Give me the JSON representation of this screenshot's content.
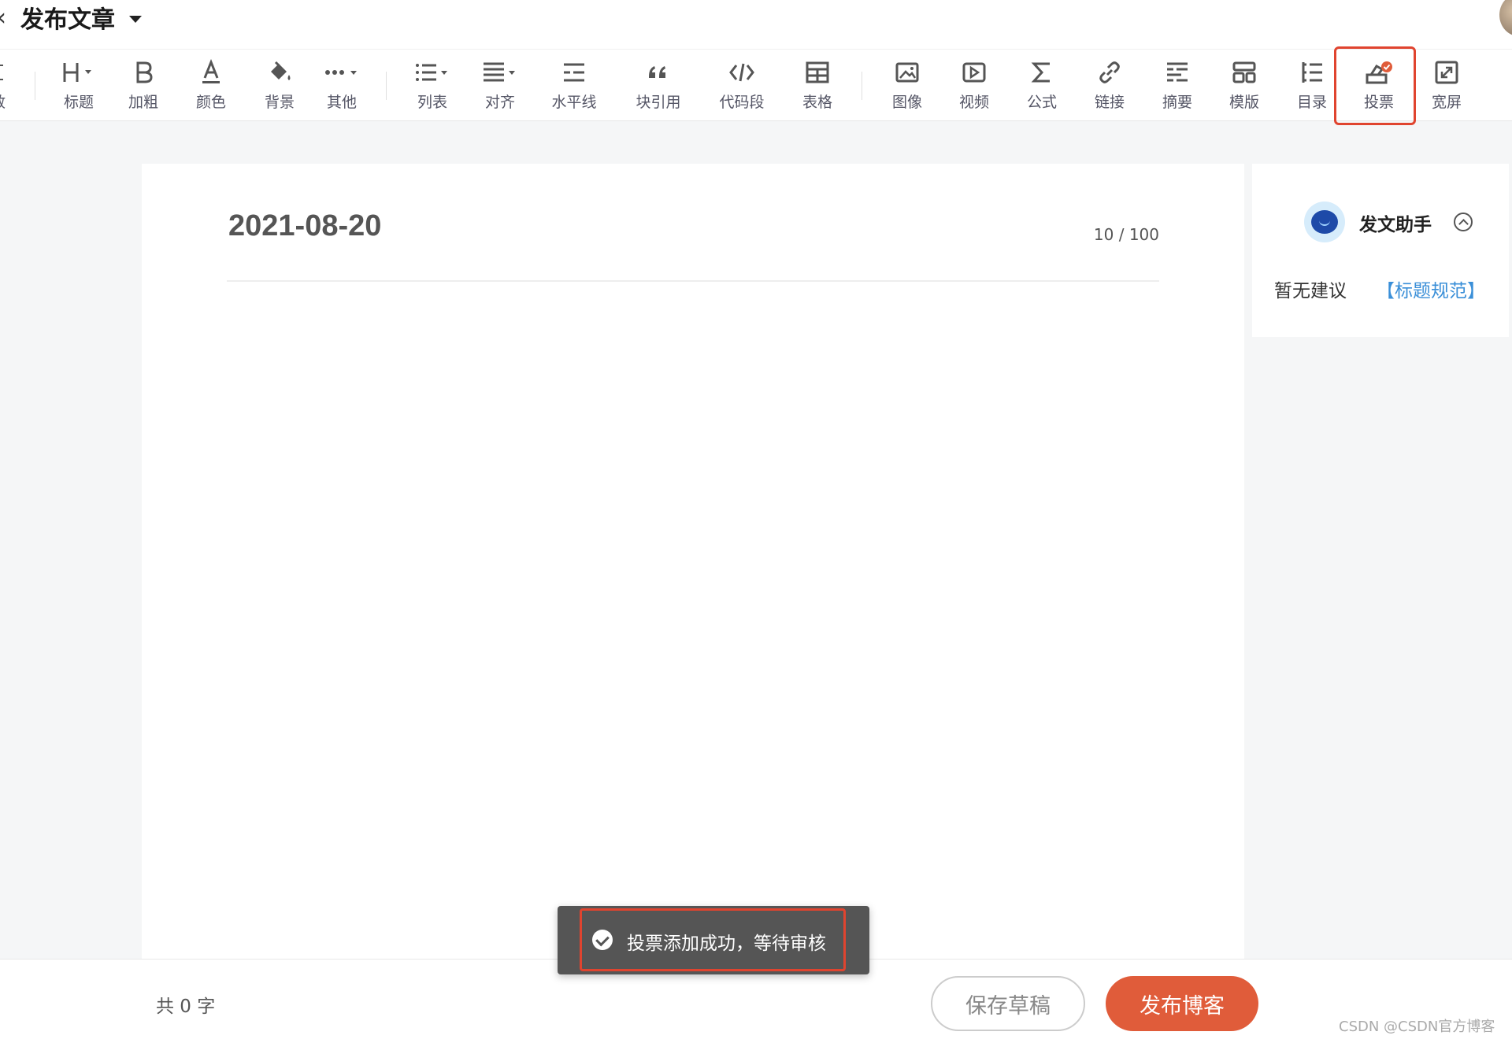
{
  "header": {
    "edge_glyph": "‹",
    "title": "发布文章"
  },
  "toolbar": {
    "partial_label": "敢",
    "items": [
      {
        "icon": "heading-icon",
        "label": "标题"
      },
      {
        "icon": "bold-icon",
        "label": "加粗"
      },
      {
        "icon": "font-color-icon",
        "label": "颜色"
      },
      {
        "icon": "background-color-icon",
        "label": "背景"
      },
      {
        "icon": "more-icon",
        "label": "其他"
      },
      {
        "icon": "list-icon",
        "label": "列表"
      },
      {
        "icon": "align-icon",
        "label": "对齐"
      },
      {
        "icon": "horizontal-rule-icon",
        "label": "水平线"
      },
      {
        "icon": "quote-icon",
        "label": "块引用"
      },
      {
        "icon": "code-icon",
        "label": "代码段"
      },
      {
        "icon": "table-icon",
        "label": "表格"
      },
      {
        "icon": "image-icon",
        "label": "图像"
      },
      {
        "icon": "video-icon",
        "label": "视频"
      },
      {
        "icon": "formula-icon",
        "label": "公式"
      },
      {
        "icon": "link-icon",
        "label": "链接"
      },
      {
        "icon": "summary-icon",
        "label": "摘要"
      },
      {
        "icon": "template-icon",
        "label": "模版"
      },
      {
        "icon": "toc-icon",
        "label": "目录"
      },
      {
        "icon": "vote-icon",
        "label": "投票"
      },
      {
        "icon": "widescreen-icon",
        "label": "宽屏"
      }
    ]
  },
  "editor": {
    "title": "2021-08-20",
    "title_count": "10 / 100"
  },
  "assistant": {
    "name": "发文助手",
    "no_suggestion": "暂无建议",
    "link": "【标题规范】"
  },
  "toast": {
    "message": "投票添加成功，等待审核"
  },
  "footer": {
    "word_count": "共 0 字",
    "save_label": "保存草稿",
    "publish_label": "发布博客"
  },
  "watermark": "CSDN @CSDN官方博客",
  "colors": {
    "accent": "#e05c3a",
    "highlight_border": "#e0442f",
    "link": "#3a8fd8",
    "toast_bg": "#555555"
  }
}
